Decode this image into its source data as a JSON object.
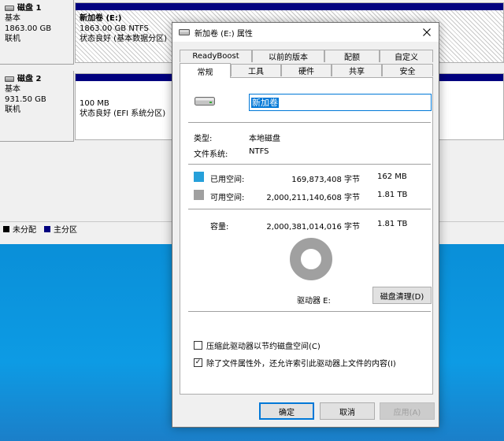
{
  "disks": [
    {
      "name": "磁盘 1",
      "type": "基本",
      "size": "1863.00 GB",
      "status": "联机",
      "partition": {
        "name": "新加卷  (E:)",
        "size": "1863.00 GB NTFS",
        "status": "状态良好 (基本数据分区)"
      }
    },
    {
      "name": "磁盘 2",
      "type": "基本",
      "size": "931.50 GB",
      "status": "联机",
      "partition": {
        "name": "",
        "size": "100 MB",
        "status": "状态良好 (EFI 系统分区)"
      }
    }
  ],
  "legend": [
    {
      "label": "未分配",
      "color": "#000000"
    },
    {
      "label": "主分区",
      "color": "#00007f"
    }
  ],
  "dialog": {
    "title": "新加卷 (E:) 属性",
    "title_icon": "drive-icon",
    "close_icon": "close-icon",
    "tabs_row1": [
      "ReadyBoost",
      "以前的版本",
      "配额",
      "自定义"
    ],
    "tabs_row2": [
      "常规",
      "工具",
      "硬件",
      "共享",
      "安全"
    ],
    "active_tab": "常规",
    "volume_name": "新加卷",
    "type_label": "类型:",
    "type_value": "本地磁盘",
    "fs_label": "文件系统:",
    "fs_value": "NTFS",
    "used": {
      "label": "已用空间:",
      "bytes": "169,873,408 字节",
      "human": "162 MB",
      "color": "#26a0da"
    },
    "free": {
      "label": "可用空间:",
      "bytes": "2,000,211,140,608 字节",
      "human": "1.81 TB",
      "color": "#a0a0a0"
    },
    "capacity": {
      "label": "容量:",
      "bytes": "2,000,381,014,016 字节",
      "human": "1.81 TB"
    },
    "used_fraction": 0.0001,
    "drive_label": "驱动器 E:",
    "cleanup_button": "磁盘清理(D)",
    "compress_checkbox": {
      "label": "压缩此驱动器以节约磁盘空间(C)",
      "checked": false
    },
    "index_checkbox": {
      "label": "除了文件属性外，还允许索引此驱动器上文件的内容(I)",
      "checked": true
    },
    "ok_button": "确定",
    "cancel_button": "取消",
    "apply_button": "应用(A)"
  }
}
